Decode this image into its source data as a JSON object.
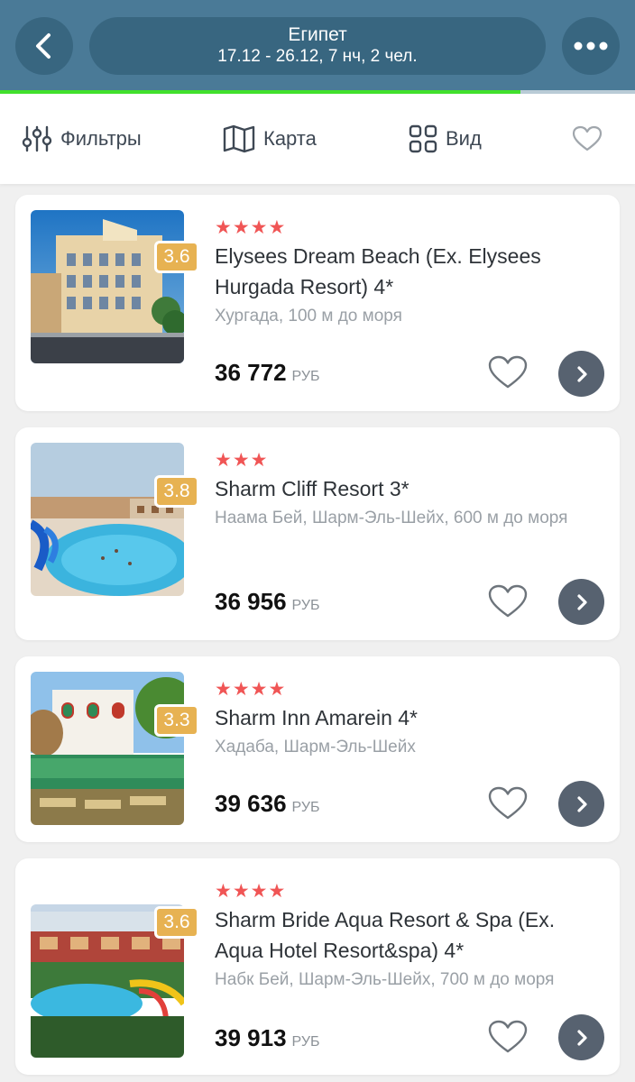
{
  "header": {
    "title": "Египет",
    "subtitle": "17.12 - 26.12, 7 нч, 2 чел.",
    "back_icon": "chevron-left-icon",
    "more_icon": "more-dots-icon",
    "progress": 0.82,
    "colors": {
      "bar": "#4a7a97",
      "pill": "#386680",
      "progress": "#41e02c"
    }
  },
  "toolbar": {
    "filters_label": "Фильтры",
    "map_label": "Карта",
    "view_label": "Вид",
    "favorite_icon": "heart-outline-icon"
  },
  "hotels": [
    {
      "stars": "★★★★",
      "rating": "3.6",
      "name": "Elysees Dream Beach (Ex. Elysees Hurgada Resort) 4*",
      "location": "Хургада, 100 м до моря",
      "price": "36 772",
      "currency": "РУБ"
    },
    {
      "stars": "★★★",
      "rating": "3.8",
      "name": "Sharm Cliff Resort 3*",
      "location": "Наама Бей, Шарм-Эль-Шейх, 600 м до моря",
      "price": "36 956",
      "currency": "РУБ"
    },
    {
      "stars": "★★★★",
      "rating": "3.3",
      "name": "Sharm Inn Amarein 4*",
      "location": "Хадаба, Шарм-Эль-Шейх",
      "price": "39 636",
      "currency": "РУБ"
    },
    {
      "stars": "★★★★",
      "rating": "3.6",
      "name": "Sharm Bride Aqua Resort & Spa (Ex. Aqua Hotel Resort&spa) 4*",
      "location": "Набк Бей, Шарм-Эль-Шейх, 700 м до моря",
      "price": "39 913",
      "currency": "РУБ"
    }
  ],
  "colors": {
    "rating_badge": "#e7b252",
    "stars": "#f05555",
    "go_button": "#576270"
  }
}
